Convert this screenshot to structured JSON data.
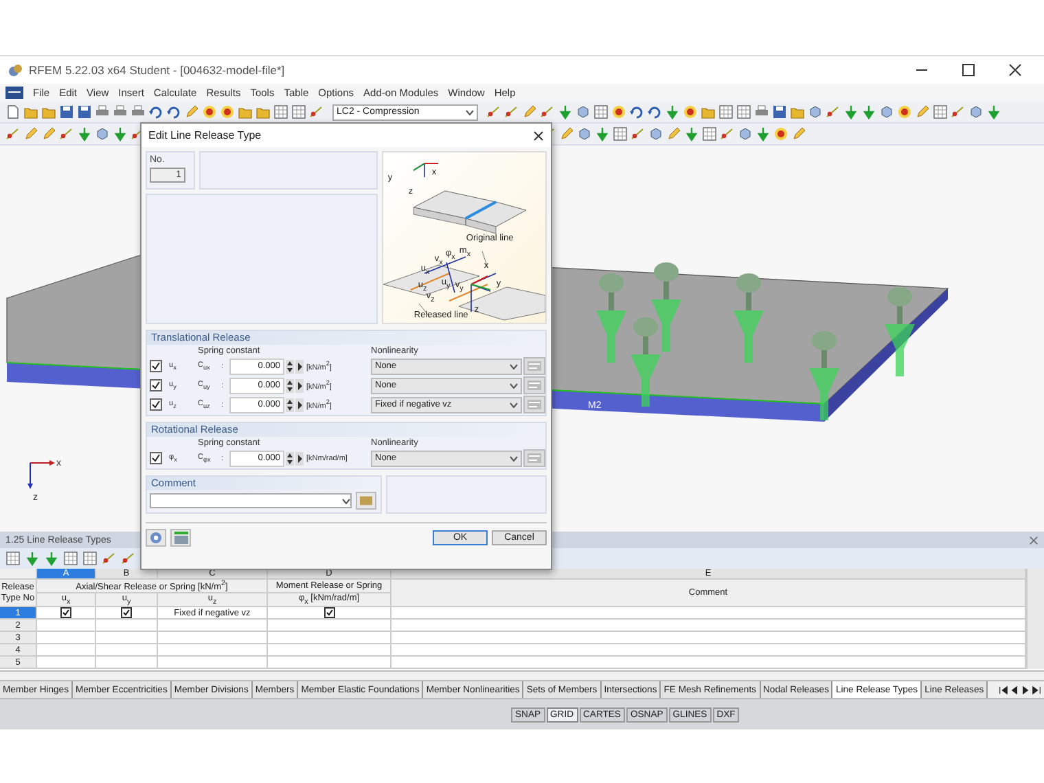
{
  "window": {
    "title": "RFEM 5.22.03 x64 Student - [004632-model-file*]"
  },
  "menu": [
    "File",
    "Edit",
    "View",
    "Insert",
    "Calculate",
    "Results",
    "Tools",
    "Table",
    "Options",
    "Add-on Modules",
    "Window",
    "Help"
  ],
  "toolbar": {
    "load_case": "LC2 - Compression"
  },
  "viewport": {
    "member_label": "M2",
    "axis_labels": [
      "x",
      "z"
    ]
  },
  "dialog": {
    "title": "Edit Line Release Type",
    "number_label": "No.",
    "number": "1",
    "diagram_labels": [
      "x",
      "y",
      "z",
      "Original line",
      "m$_{x}$",
      "φ$_{x}$",
      "v$_{x}$",
      "x",
      "u$_{x}$",
      "u$_{z}$",
      "u$_{y}$",
      "v$_{y}$",
      "y",
      "v$_{z}$",
      "z",
      "Released line"
    ],
    "translational": {
      "title": "Translational Release",
      "spring_header": "Spring constant",
      "nonlinearity_header": "Nonlinearity",
      "rows": [
        {
          "checked": true,
          "label": "u$_{x}$",
          "constant": "C$_{ux}$",
          "separator": ":",
          "value": "0.000",
          "unit": "[kN/m$^{2}$]",
          "nonlinearity": "None"
        },
        {
          "checked": true,
          "label": "u$_{y}$",
          "constant": "C$_{uy}$",
          "separator": ":",
          "value": "0.000",
          "unit": "[kN/m$^{2}$]",
          "nonlinearity": "None"
        },
        {
          "checked": true,
          "label": "u$_{z}$",
          "constant": "C$_{uz}$",
          "separator": ":",
          "value": "0.000",
          "unit": "[kN/m$^{2}$]",
          "nonlinearity": "Fixed if negative vz"
        }
      ]
    },
    "rotational": {
      "title": "Rotational Release",
      "spring_header": "Spring constant",
      "nonlinearity_header": "Nonlinearity",
      "rows": [
        {
          "checked": true,
          "label": "φ$_{x}$",
          "constant": "C$_{φx}$",
          "separator": ":",
          "value": "0.000",
          "unit": "[kNm/rad/m]",
          "nonlinearity": "None"
        }
      ]
    },
    "comment_title": "Comment",
    "buttons": [
      {
        "label": "OK",
        "default": true
      },
      {
        "label": "Cancel",
        "default": false
      }
    ]
  },
  "panel": {
    "title": "1.25 Line Release Types"
  },
  "table": {
    "corner_label": "Release Type No",
    "columns": [
      {
        "letter": "A",
        "selected": true
      },
      {
        "letter": "B",
        "selected": false
      },
      {
        "letter": "C",
        "selected": false
      },
      {
        "letter": "D",
        "selected": false
      },
      {
        "letter": "E",
        "selected": false
      }
    ],
    "group_headers": [
      "Axial/Shear Release or Spring [kN/m$^{2}$]",
      "Moment Release or Spring",
      "Comment"
    ],
    "sub_headers": [
      "u$_{x}$",
      "u$_{y}$",
      "u$_{z}$",
      "φ$_{x}$ [kNm/rad/m]"
    ],
    "rows": [
      {
        "no": "1",
        "selected": true,
        "ux": true,
        "uy": true,
        "uz": "Fixed if negative vz",
        "phi": true
      },
      {
        "no": "2",
        "selected": false,
        "ux": false,
        "uy": false,
        "phi": false
      },
      {
        "no": "3",
        "selected": false,
        "ux": false,
        "uy": false,
        "phi": false
      },
      {
        "no": "4",
        "selected": false,
        "ux": false,
        "uy": false,
        "phi": false
      },
      {
        "no": "5",
        "selected": false,
        "ux": false,
        "uy": false,
        "phi": false
      }
    ]
  },
  "sheet_tabs": [
    {
      "label": "Member Hinges",
      "selected": false
    },
    {
      "label": "Member Eccentricities",
      "selected": false
    },
    {
      "label": "Member Divisions",
      "selected": false
    },
    {
      "label": "Members",
      "selected": false
    },
    {
      "label": "Member Elastic Foundations",
      "selected": false
    },
    {
      "label": "Member Nonlinearities",
      "selected": false
    },
    {
      "label": "Sets of Members",
      "selected": false
    },
    {
      "label": "Intersections",
      "selected": false
    },
    {
      "label": "FE Mesh Refinements",
      "selected": false
    },
    {
      "label": "Nodal Releases",
      "selected": false
    },
    {
      "label": "Line Release Types",
      "selected": true
    },
    {
      "label": "Line Releases",
      "selected": false
    }
  ],
  "status_buttons": [
    {
      "label": "SNAP",
      "on": false
    },
    {
      "label": "GRID",
      "on": true
    },
    {
      "label": "CARTES",
      "on": false
    },
    {
      "label": "OSNAP",
      "on": false
    },
    {
      "label": "GLINES",
      "on": false
    },
    {
      "label": "DXF",
      "on": false
    }
  ]
}
